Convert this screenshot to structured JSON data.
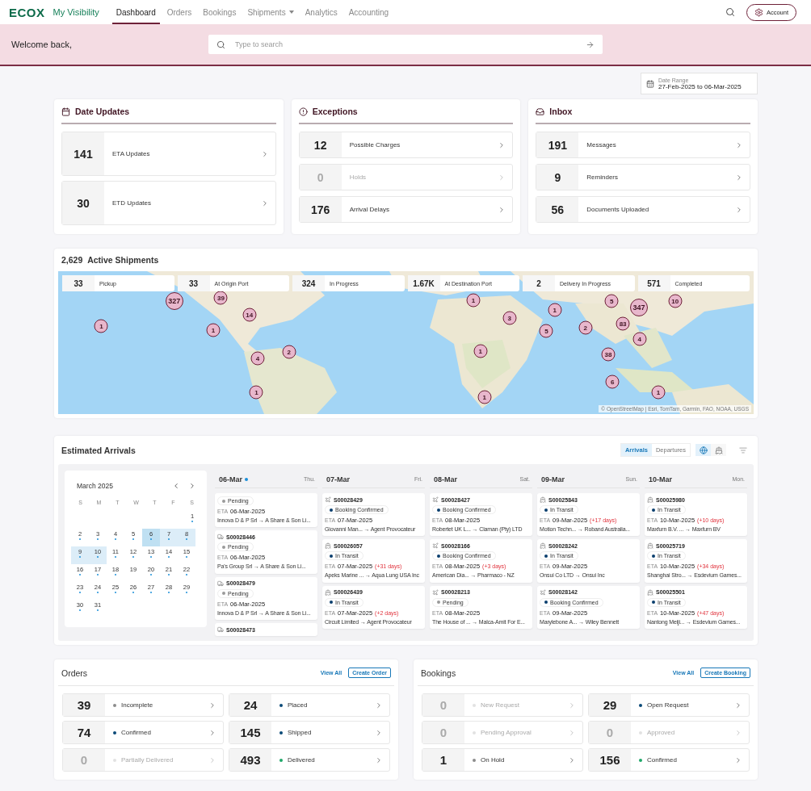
{
  "nav": {
    "logo": "ECOX",
    "product": "My Visibility",
    "tabs": [
      {
        "label": "Dashboard",
        "selected": true,
        "dropdown": false
      },
      {
        "label": "Orders",
        "selected": false,
        "dropdown": false
      },
      {
        "label": "Bookings",
        "selected": false,
        "dropdown": false
      },
      {
        "label": "Shipments",
        "selected": false,
        "dropdown": true
      },
      {
        "label": "Analytics",
        "selected": false,
        "dropdown": false
      },
      {
        "label": "Accounting",
        "selected": false,
        "dropdown": false
      }
    ],
    "account": "Account"
  },
  "welcome": {
    "greeting": "Welcome back,",
    "search": {
      "placeholder": "Type to search"
    }
  },
  "date_range": {
    "label": "Date Range",
    "value": "27-Feb-2025 to 06-Mar-2025"
  },
  "summary_cards": [
    {
      "kind": "calendar",
      "title": "Date Updates",
      "tall": true,
      "rows": [
        {
          "count": "141",
          "label": "ETA Updates",
          "disabled": false
        },
        {
          "count": "30",
          "label": "ETD Updates",
          "disabled": false
        }
      ]
    },
    {
      "kind": "alert",
      "title": "Exceptions",
      "tall": false,
      "rows": [
        {
          "count": "12",
          "label": "Possible Charges",
          "disabled": false
        },
        {
          "count": "0",
          "label": "Holds",
          "disabled": true
        },
        {
          "count": "176",
          "label": "Arrival Delays",
          "disabled": false
        }
      ]
    },
    {
      "kind": "inbox",
      "title": "Inbox",
      "tall": false,
      "rows": [
        {
          "count": "191",
          "label": "Messages",
          "disabled": false
        },
        {
          "count": "9",
          "label": "Reminders",
          "disabled": false
        },
        {
          "count": "56",
          "label": "Documents Uploaded",
          "disabled": false
        }
      ]
    }
  ],
  "active_shipments": {
    "count": "2,629",
    "title": "Active Shipments",
    "stages": [
      {
        "count": "33",
        "label": "Pickup"
      },
      {
        "count": "33",
        "label": "At Origin Port"
      },
      {
        "count": "324",
        "label": "In Progress"
      },
      {
        "count": "1.67K",
        "label": "At Destination Port"
      },
      {
        "count": "2",
        "label": "Delivery In Progress"
      },
      {
        "count": "571",
        "label": "Completed"
      }
    ],
    "map": {
      "kind": "picture",
      "clusters": [
        {
          "label": "327"
        },
        {
          "label": "39"
        },
        {
          "label": "14"
        },
        {
          "label": "1"
        },
        {
          "label": "1"
        },
        {
          "label": "4"
        },
        {
          "label": "2"
        },
        {
          "label": "1"
        },
        {
          "label": "1"
        },
        {
          "label": "3"
        },
        {
          "label": "1"
        },
        {
          "label": "5"
        },
        {
          "label": "2"
        },
        {
          "label": "5"
        },
        {
          "label": "347"
        },
        {
          "label": "83"
        },
        {
          "label": "10"
        },
        {
          "label": "4"
        },
        {
          "label": "38"
        },
        {
          "label": "1"
        },
        {
          "label": "6"
        },
        {
          "label": "1"
        },
        {
          "label": "1"
        }
      ],
      "attribution": "© OpenStreetMap | Esri, TomTam, Garmin, FAO, NOAA, USGS"
    }
  },
  "estimated_arrivals": {
    "title": "Estimated Arrivals",
    "toggle": [
      {
        "label": "Arrivals",
        "selected": true
      },
      {
        "label": "Departures",
        "selected": false
      }
    ],
    "views": [
      {
        "kind": "globe",
        "selected": true
      },
      {
        "kind": "ship",
        "selected": false
      }
    ],
    "calendar": {
      "month": "March 2025",
      "weekdays": [
        "S",
        "M",
        "T",
        "W",
        "T",
        "F",
        "S"
      ],
      "weeks": [
        {
          "days": [
            {
              "label": "1",
              "dot": true,
              "selected": false,
              "in_range": false
            }
          ]
        },
        {
          "days": [
            {
              "label": "2",
              "dot": true,
              "selected": false,
              "in_range": false
            },
            {
              "label": "3",
              "dot": true,
              "selected": false,
              "in_range": false
            },
            {
              "label": "4",
              "dot": true,
              "selected": false,
              "in_range": false
            },
            {
              "label": "5",
              "dot": true,
              "selected": false,
              "in_range": false
            },
            {
              "label": "6",
              "dot": true,
              "selected": true,
              "in_range": true
            },
            {
              "label": "7",
              "dot": true,
              "selected": false,
              "in_range": true
            },
            {
              "label": "8",
              "dot": true,
              "selected": false,
              "in_range": true
            }
          ]
        },
        {
          "days": [
            {
              "label": "9",
              "dot": true,
              "selected": false,
              "in_range": true
            },
            {
              "label": "10",
              "dot": true,
              "selected": false,
              "in_range": true
            },
            {
              "label": "11",
              "dot": true,
              "selected": false,
              "in_range": false
            },
            {
              "label": "12",
              "dot": true,
              "selected": false,
              "in_range": false
            },
            {
              "label": "13",
              "dot": true,
              "selected": false,
              "in_range": false
            },
            {
              "label": "14",
              "dot": true,
              "selected": false,
              "in_range": false
            },
            {
              "label": "15",
              "dot": true,
              "selected": false,
              "in_range": false
            }
          ]
        },
        {
          "days": [
            {
              "label": "16",
              "dot": true,
              "selected": false,
              "in_range": false
            },
            {
              "label": "17",
              "dot": true,
              "selected": false,
              "in_range": false
            },
            {
              "label": "18",
              "dot": true,
              "selected": false,
              "in_range": false
            },
            {
              "label": "19",
              "dot": false,
              "selected": false,
              "in_range": false
            },
            {
              "label": "20",
              "dot": true,
              "selected": false,
              "in_range": false
            },
            {
              "label": "21",
              "dot": true,
              "selected": false,
              "in_range": false
            },
            {
              "label": "22",
              "dot": true,
              "selected": false,
              "in_range": false
            }
          ]
        },
        {
          "days": [
            {
              "label": "23",
              "dot": true,
              "selected": false,
              "in_range": false
            },
            {
              "label": "24",
              "dot": true,
              "selected": false,
              "in_range": false
            },
            {
              "label": "25",
              "dot": true,
              "selected": false,
              "in_range": false
            },
            {
              "label": "26",
              "dot": true,
              "selected": false,
              "in_range": false
            },
            {
              "label": "27",
              "dot": true,
              "selected": false,
              "in_range": false
            },
            {
              "label": "28",
              "dot": true,
              "selected": false,
              "in_range": false
            },
            {
              "label": "29",
              "dot": true,
              "selected": false,
              "in_range": false
            }
          ]
        },
        {
          "days": [
            {
              "label": "30",
              "dot": true,
              "selected": false,
              "in_range": false
            },
            {
              "label": "31",
              "dot": true,
              "selected": false,
              "in_range": false
            }
          ]
        }
      ]
    },
    "days": [
      {
        "date": "06-Mar",
        "weekday": "Thu.",
        "today": true,
        "shipments": [
          {
            "status": {
              "label": "Pending",
              "kind": "pending"
            },
            "eta_label": "ETA",
            "eta": "06-Mar-2025",
            "route": "Innova D & P Srl → A Share & Son Li..."
          },
          {
            "kind": "truck",
            "id": "S00028446",
            "status": {
              "label": "Pending",
              "kind": "pending"
            },
            "eta_label": "ETA",
            "eta": "06-Mar-2025",
            "route": "Pa's Group Srl → A Share & Son Li..."
          },
          {
            "kind": "truck",
            "id": "S00028479",
            "status": {
              "label": "Pending",
              "kind": "pending"
            },
            "eta_label": "ETA",
            "eta": "06-Mar-2025",
            "route": "Innova D & P Srl → A Share & Son Li..."
          },
          {
            "kind": "truck",
            "id": "S00028473"
          }
        ]
      },
      {
        "date": "07-Mar",
        "weekday": "Fri.",
        "today": false,
        "shipments": [
          {
            "kind": "air",
            "id": "S00028429",
            "status": {
              "label": "Booking Confirmed",
              "kind": "active"
            },
            "eta_label": "ETA",
            "eta": "07-Mar-2025",
            "route": "Giovanni Man... → Agent Provocateur"
          },
          {
            "kind": "ocean",
            "id": "S00026057",
            "status": {
              "label": "In Transit",
              "kind": "active"
            },
            "eta_label": "ETA",
            "eta": "07-Mar-2025",
            "delay": "(+31 days)",
            "route": "Apeks Marine ... → Aqua Lung USA Inc"
          },
          {
            "kind": "ocean",
            "id": "S00026439",
            "status": {
              "label": "In Transit",
              "kind": "active"
            },
            "eta_label": "ETA",
            "eta": "07-Mar-2025",
            "delay": "(+2 days)",
            "route": "Circuit Limited → Agent Provocateur"
          }
        ]
      },
      {
        "date": "08-Mar",
        "weekday": "Sat.",
        "today": false,
        "shipments": [
          {
            "kind": "air",
            "id": "S00028427",
            "status": {
              "label": "Booking Confirmed",
              "kind": "active"
            },
            "eta_label": "ETA",
            "eta": "08-Mar-2025",
            "route": "Robertet UK L... → Claman (Pty) LTD"
          },
          {
            "kind": "air",
            "id": "S00028166",
            "status": {
              "label": "Booking Confirmed",
              "kind": "active"
            },
            "eta_label": "ETA",
            "eta": "08-Mar-2025",
            "delay": "(+3 days)",
            "route": "American Dia... → Pharmaco - NZ"
          },
          {
            "kind": "air",
            "id": "S00028213",
            "status": {
              "label": "Pending",
              "kind": "pending"
            },
            "eta_label": "ETA",
            "eta": "08-Mar-2025",
            "route": "The House of ... → Malca-Amit For E..."
          }
        ]
      },
      {
        "date": "09-Mar",
        "weekday": "Sun.",
        "today": false,
        "shipments": [
          {
            "kind": "ocean",
            "id": "S00025843",
            "status": {
              "label": "In Transit",
              "kind": "active"
            },
            "eta_label": "ETA",
            "eta": "09-Mar-2025",
            "delay": "(+17 days)",
            "route": "Motion Techn... → Roband Australia..."
          },
          {
            "kind": "ocean",
            "id": "S00028242",
            "status": {
              "label": "In Transit",
              "kind": "active"
            },
            "eta_label": "ETA",
            "eta": "09-Mar-2025",
            "route": "Onsui Co LTD → Onsui Inc"
          },
          {
            "kind": "air",
            "id": "S00028142",
            "status": {
              "label": "Booking Confirmed",
              "kind": "active"
            },
            "eta_label": "ETA",
            "eta": "09-Mar-2025",
            "route": "Marylebone A... → Wiley Bennett"
          }
        ]
      },
      {
        "date": "10-Mar",
        "weekday": "Mon.",
        "today": false,
        "shipments": [
          {
            "kind": "ocean",
            "id": "S00025980",
            "status": {
              "label": "In Transit",
              "kind": "active"
            },
            "eta_label": "ETA",
            "eta": "10-Mar-2025",
            "delay": "(+10 days)",
            "route": "Maxfurn B.V. ... → Maxfurn BV"
          },
          {
            "kind": "ocean",
            "id": "S00025719",
            "status": {
              "label": "In Transit",
              "kind": "active"
            },
            "eta_label": "ETA",
            "eta": "10-Mar-2025",
            "delay": "(+34 days)",
            "route": "Shanghai Stro... → Esdevium Games..."
          },
          {
            "kind": "ocean",
            "id": "S00025501",
            "status": {
              "label": "In Transit",
              "kind": "active"
            },
            "eta_label": "ETA",
            "eta": "10-Mar-2025",
            "delay": "(+47 days)",
            "route": "Nantong Meiji... → Esdevium Games..."
          }
        ]
      }
    ]
  },
  "panels": [
    {
      "title": "Orders",
      "view_all": "View All",
      "create": "Create Order",
      "items": [
        {
          "count": "39",
          "label": "Incomplete",
          "color": "#8c8c8c",
          "disabled": false
        },
        {
          "count": "24",
          "label": "Placed",
          "color": "#0b4a78",
          "disabled": false
        },
        {
          "count": "74",
          "label": "Confirmed",
          "color": "#0b4a78",
          "disabled": false
        },
        {
          "count": "145",
          "label": "Shipped",
          "color": "#0b4a78",
          "disabled": false
        },
        {
          "count": "0",
          "label": "Partially Delivered",
          "color": "#e2e2e2",
          "disabled": true
        },
        {
          "count": "493",
          "label": "Delivered",
          "color": "#1fa86a",
          "disabled": false
        }
      ]
    },
    {
      "title": "Bookings",
      "view_all": "View All",
      "create": "Create Booking",
      "items": [
        {
          "count": "0",
          "label": "New Request",
          "color": "#e2e2e2",
          "disabled": true
        },
        {
          "count": "29",
          "label": "Open Request",
          "color": "#0b4a78",
          "disabled": false
        },
        {
          "count": "0",
          "label": "Pending Approval",
          "color": "#e2e2e2",
          "disabled": true
        },
        {
          "count": "0",
          "label": "Approved",
          "color": "#e2e2e2",
          "disabled": true
        },
        {
          "count": "1",
          "label": "On Hold",
          "color": "#8c8c8c",
          "disabled": false
        },
        {
          "count": "156",
          "label": "Confirmed",
          "color": "#1fa86a",
          "disabled": false
        }
      ]
    }
  ]
}
